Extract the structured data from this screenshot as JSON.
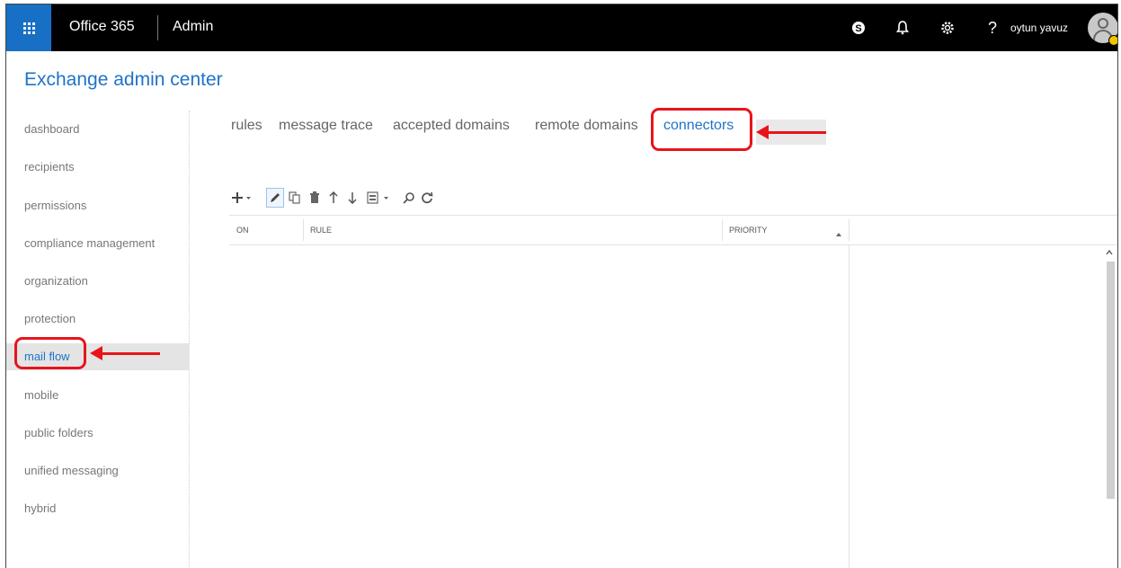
{
  "topbar": {
    "brand": "Office 365",
    "section": "Admin",
    "username": "oytun yavuz",
    "icons": [
      "waffle-icon",
      "skype-icon",
      "bell-icon",
      "gear-icon",
      "help-icon",
      "avatar-icon"
    ],
    "help_glyph": "?"
  },
  "app": {
    "title": "Exchange admin center"
  },
  "sidebar": {
    "items": [
      {
        "label": "dashboard"
      },
      {
        "label": "recipients"
      },
      {
        "label": "permissions"
      },
      {
        "label": "compliance management"
      },
      {
        "label": "organization"
      },
      {
        "label": "protection"
      },
      {
        "label": "mail flow",
        "selected": true
      },
      {
        "label": "mobile"
      },
      {
        "label": "public folders"
      },
      {
        "label": "unified messaging"
      },
      {
        "label": "hybrid"
      }
    ]
  },
  "tabs": [
    {
      "label": "rules"
    },
    {
      "label": "message trace"
    },
    {
      "label": "accepted domains"
    },
    {
      "label": "remote domains"
    },
    {
      "label": "connectors",
      "active": true
    }
  ],
  "toolbar": {
    "buttons": [
      "add-icon",
      "edit-icon",
      "copy-icon",
      "delete-icon",
      "move-up-icon",
      "move-down-icon",
      "report-icon",
      "search-icon",
      "refresh-icon"
    ]
  },
  "grid": {
    "columns": [
      {
        "label": "ON"
      },
      {
        "label": "RULE"
      },
      {
        "label": "PRIORITY",
        "sort": "ascending"
      }
    ]
  },
  "annotations": {
    "color": "#e8141b"
  },
  "colors": {
    "accent": "#1f73c8",
    "topbar": "#000000",
    "waffle": "#1770c5"
  }
}
